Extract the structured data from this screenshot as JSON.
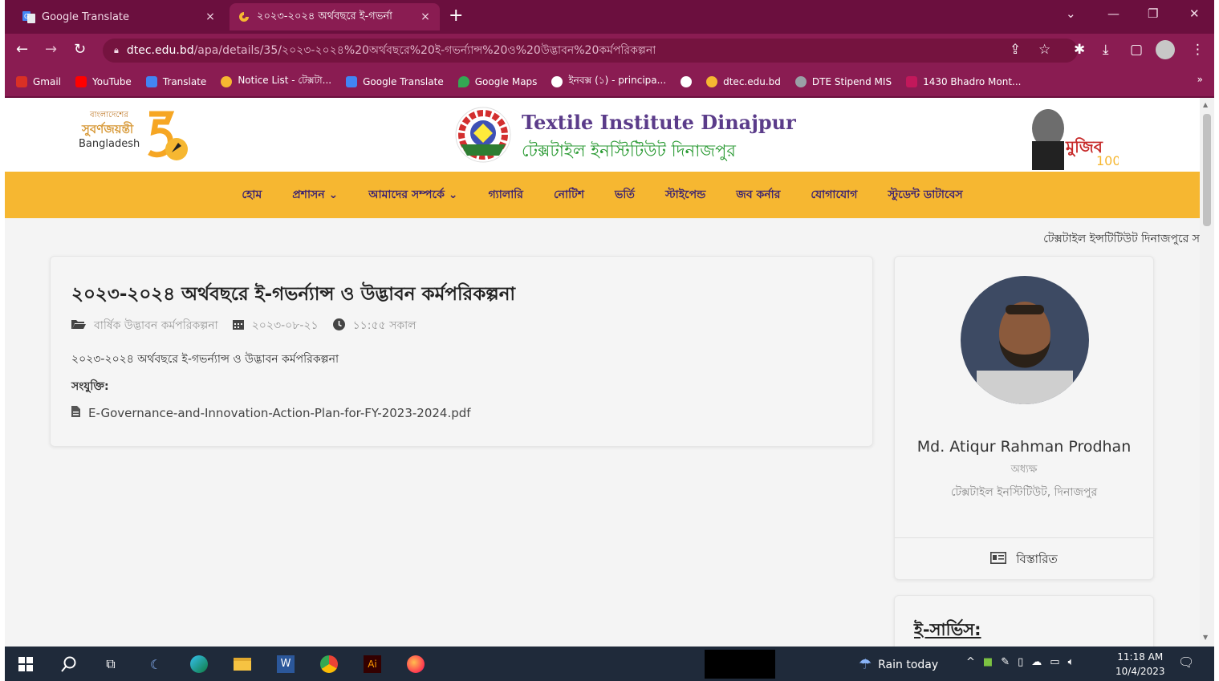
{
  "browser": {
    "tabs": [
      {
        "title": "Google Translate",
        "close": "×"
      },
      {
        "title": "২০২৩-২০২৪ অর্থবছরে ই-গভর্না",
        "close": "×"
      }
    ],
    "new_tab": "+",
    "url_host": "dtec.edu.bd",
    "url_path": "/apa/details/35/২০২৩-২০২৪%20অর্থবছরে%20ই-গভর্ন্যান্স%20ও%20উদ্ভাবন%20কর্মপরিকল্পনা",
    "bookmarks": [
      {
        "label": "Gmail",
        "color": "#d93025"
      },
      {
        "label": "YouTube",
        "color": "#ff0000"
      },
      {
        "label": "Translate",
        "color": "#4285f4"
      },
      {
        "label": "Notice List - টেক্সটা...",
        "color": "#f6b731"
      },
      {
        "label": "Google Translate",
        "color": "#4285f4"
      },
      {
        "label": "Google Maps",
        "color": "#34a853"
      },
      {
        "label": "ইনবক্স (১) - principa...",
        "color": "#ffffff"
      },
      {
        "label": "",
        "color": "#ffffff"
      },
      {
        "label": "dtec.edu.bd",
        "color": "#f6b731"
      },
      {
        "label": "DTE Stipend MIS",
        "color": "#9aa0a6"
      },
      {
        "label": "1430 Bhadro Mont...",
        "color": "#c2185b"
      }
    ],
    "bookmarks_more": "»"
  },
  "site": {
    "logo50": {
      "line1": "বাংলাদেশের",
      "line2": "সুবর্ণজয়ন্তী",
      "country": "Bangladesh"
    },
    "title_en": "Textile Institute Dinajpur",
    "title_bn": "টেক্সটাইল ইনস্টিটিউট দিনাজপুর",
    "nav": [
      "হোম",
      "প্রশাসন ⌄",
      "আমাদের সম্পর্কে ⌄",
      "গ্যালারি",
      "নোটিশ",
      "ভর্তি",
      "স্টাইপেন্ড",
      "জব কর্নার",
      "যোগাযোগ",
      "স্টুডেন্ট ডাটাবেস"
    ],
    "marquee": "টেক্সটাইল ইন্সটিটিউট দিনাজপুরে স"
  },
  "post": {
    "title": "২০২৩-২০২৪ অর্থবছরে ই-গভর্ন্যান্স ও উদ্ভাবন কর্মপরিকল্পনা",
    "category": "বার্ষিক উদ্ভাবন কর্মপরিকল্পনা",
    "date": "২০২৩-০৮-২১",
    "time": "১১:৫৫ সকাল",
    "body": "২০২৩-২০২৪ অর্থবছরে ই-গভর্ন্যান্স ও উদ্ভাবন কর্মপরিকল্পনা",
    "attachment_label": "সংযুক্তি:",
    "attachment_file": "E-Governance-and-Innovation-Action-Plan-for-FY-2023-2024.pdf"
  },
  "profile": {
    "name": "Md. Atiqur Rahman Prodhan",
    "role": "অধ্যক্ষ",
    "org": "টেক্সটাইল ইনস্টিটিউট, দিনাজপুর",
    "details": "বিস্তারিত"
  },
  "eservice": {
    "title": "ই-সার্ভিস:"
  },
  "taskbar": {
    "weather": "Rain today",
    "time": "11:18 AM",
    "date": "10/4/2023"
  }
}
